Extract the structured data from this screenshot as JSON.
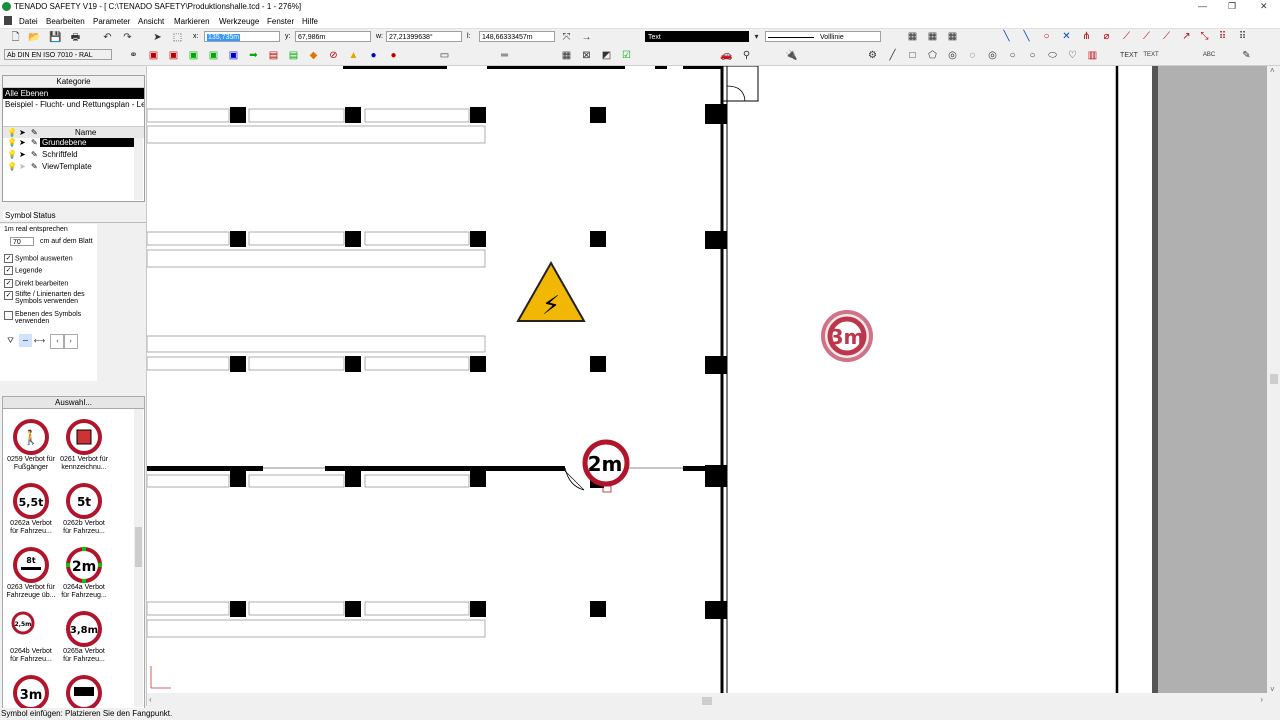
{
  "window": {
    "title": "TENADO SAFETY V19 - [ C:\\TENADO SAFETY\\Produktionshalle.tcd - 1 - 276%]"
  },
  "menu": [
    "Datei",
    "Bearbeiten",
    "Parameter",
    "Ansicht",
    "Markieren",
    "Werkzeuge",
    "Fenster",
    "Hilfe"
  ],
  "coords": {
    "x_label": "x:",
    "x_value": "135,735m",
    "y_label": "y:",
    "y_value": "67,986m",
    "w_label": "w:",
    "w_value": "27,21399638°",
    "l_label": "l:",
    "l_value": "148,66333457m"
  },
  "style": {
    "text_select": "Text",
    "line_select": "Volllinie",
    "norm_select": "Ab DIN EN ISO 7010 - RAL"
  },
  "layers": {
    "header": "Kategorie",
    "items": [
      "Alle Ebenen",
      "Beispiel - Flucht- und Rettungsplan - Le"
    ],
    "name_header": "Name",
    "rows": [
      "Grundebene",
      "Schriftfeld",
      "ViewTemplate"
    ]
  },
  "symbol_tabs": [
    "Symbol",
    "Status"
  ],
  "symbol_settings": {
    "scale_label": "1m real entsprechen",
    "scale_value": "70",
    "scale_unit": "cm auf dem Blatt",
    "options": [
      {
        "label": "Symbol auswerten",
        "checked": true
      },
      {
        "label": "Legende",
        "checked": true
      },
      {
        "label": "Direkt bearbeiten",
        "checked": true
      },
      {
        "label": "Stifte / Linienarten des Symbols verwenden",
        "checked": true
      },
      {
        "label": "Ebenen des Symbols verwenden",
        "checked": false
      }
    ]
  },
  "symbol_list": {
    "button": "Auswahl...",
    "items": [
      {
        "code": "0259 Verbot für",
        "desc": "Fußgänger",
        "glyph": "🚶"
      },
      {
        "code": "0261 Verbot für",
        "desc": "kennzeichnu...",
        "glyph": "▣"
      },
      {
        "code": "0262a Verbot",
        "desc": "für Fahrzeu...",
        "glyph": "5,5t"
      },
      {
        "code": "0262b Verbot",
        "desc": "für Fahrzeu...",
        "glyph": "5t"
      },
      {
        "code": "0263 Verbot für",
        "desc": "Fahrzeuge üb...",
        "glyph": "8t"
      },
      {
        "code": "0264a Verbot",
        "desc": "für Fahrzeug...",
        "glyph": "2m"
      },
      {
        "code": "0264b Verbot",
        "desc": "für Fahrzeu...",
        "glyph": "2,5m"
      },
      {
        "code": "0265a Verbot",
        "desc": "für Fahrzeu...",
        "glyph": "3,8m"
      },
      {
        "code": "",
        "desc": "",
        "glyph": "3m"
      },
      {
        "code": "",
        "desc": "",
        "glyph": "🚚"
      }
    ]
  },
  "canvas_signs": {
    "height_2m": "2m",
    "height_3m": "3m",
    "warning": "⚡"
  },
  "status": "Symbol einfügen: Platzieren Sie den Fangpunkt.",
  "colors": {
    "sign_red": "#b1152b",
    "warning_yellow": "#f2b705",
    "selection_blue": "#3399ff"
  }
}
